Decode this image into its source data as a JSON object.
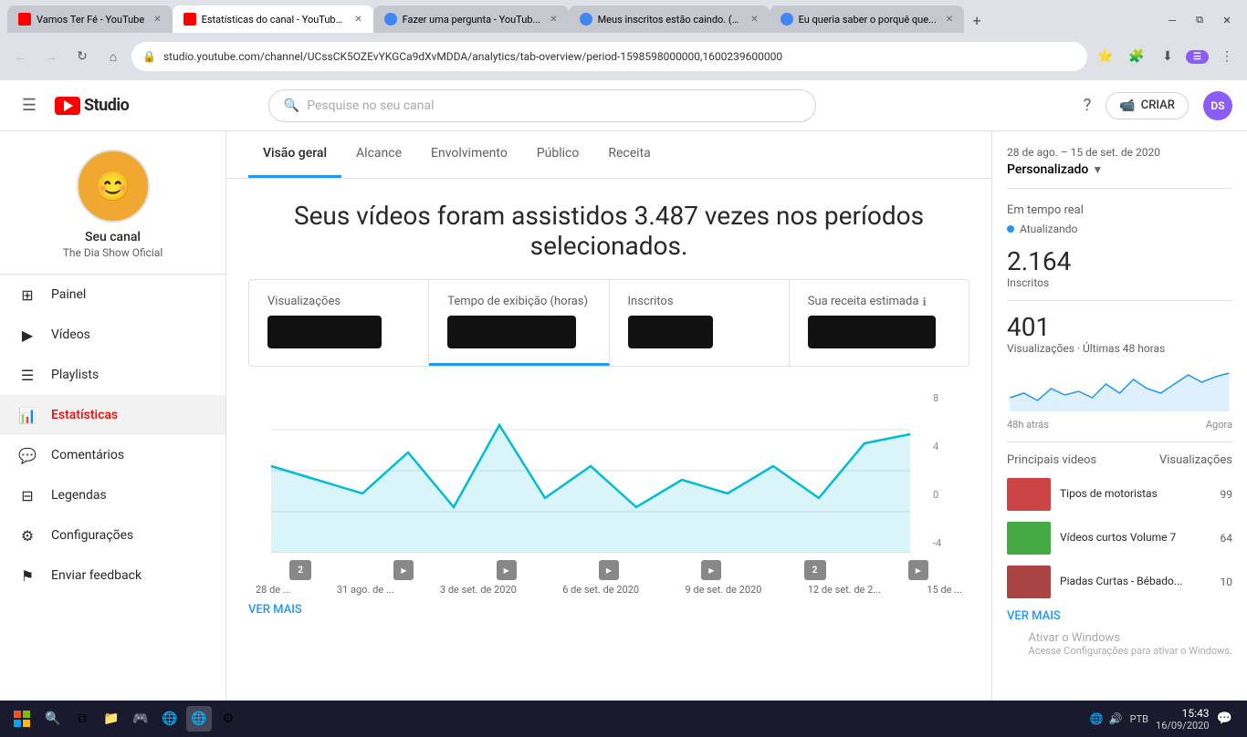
{
  "browser": {
    "tabs": [
      {
        "label": "Vamos Ter Fé - YouTube",
        "active": false,
        "type": "yt"
      },
      {
        "label": "Estatísticas do canal - YouTube...",
        "active": true,
        "type": "yt"
      },
      {
        "label": "Fazer uma pergunta - YouTub...",
        "active": false,
        "type": "g"
      },
      {
        "label": "Meus inscritos estão caindo. (M...",
        "active": false,
        "type": "g"
      },
      {
        "label": "Eu queria saber o porquê que...",
        "active": false,
        "type": "g"
      }
    ],
    "address": "studio.youtube.com/channel/UCssCK5OZEvYKGCa9dXvMDDA/analytics/tab-overview/period-1598598000000,1600239600000",
    "actions": [
      "⭐",
      "🧩",
      "⬇",
      "☰"
    ]
  },
  "header": {
    "search_placeholder": "Pesquise no seu canal",
    "create_label": "CRIAR",
    "logo_text": "Studio"
  },
  "sidebar": {
    "channel_name": "Seu canal",
    "channel_handle": "The Dia Show Oficial",
    "nav_items": [
      {
        "label": "Painel",
        "icon": "grid",
        "active": false
      },
      {
        "label": "Vídeos",
        "icon": "video",
        "active": false
      },
      {
        "label": "Playlists",
        "icon": "list",
        "active": false
      },
      {
        "label": "Estatísticas",
        "icon": "bar-chart",
        "active": true
      },
      {
        "label": "Comentários",
        "icon": "comment",
        "active": false
      },
      {
        "label": "Legendas",
        "icon": "subtitles",
        "active": false
      },
      {
        "label": "Configurações",
        "icon": "settings",
        "active": false
      },
      {
        "label": "Enviar feedback",
        "icon": "feedback",
        "active": false
      }
    ]
  },
  "analytics": {
    "tabs": [
      {
        "label": "Visão geral",
        "active": true
      },
      {
        "label": "Alcance",
        "active": false
      },
      {
        "label": "Envolvimento",
        "active": false
      },
      {
        "label": "Público",
        "active": false
      },
      {
        "label": "Receita",
        "active": false
      }
    ],
    "hero_text": "Seus vídeos foram assistidos 3.487 vezes nos períodos selecionados.",
    "stats": [
      {
        "label": "Visualizações",
        "active": false
      },
      {
        "label": "Tempo de exibição (horas)",
        "active": true
      },
      {
        "label": "Inscritos",
        "active": false
      },
      {
        "label": "Sua receita estimada",
        "active": false
      }
    ],
    "chart_labels": {
      "y_values": [
        "8",
        "4",
        "0",
        "-4"
      ]
    },
    "date_labels": [
      "28 de ...",
      "31 ago. de ...",
      "3 de set. de 2020",
      "6 de set. de 2020",
      "9 de set. de 2020",
      "12 de set. de 2...",
      "15 de ..."
    ],
    "ver_mais": "VER MAIS"
  },
  "right_panel": {
    "date_range": "28 de ago. – 15 de set. de 2020",
    "period": "Personalizado",
    "realtime_title": "Em tempo real",
    "realtime_status": "Atualizando",
    "subscribers_count": "2.164",
    "subscribers_label": "Inscritos",
    "views_count": "401",
    "views_label": "Visualizações · Últimas 48 horas",
    "time_start": "48h atrás",
    "time_end": "Agora",
    "top_videos_title": "Principais vídeos",
    "views_header": "Visualizações",
    "ver_mais": "VER MAIS",
    "videos": [
      {
        "title": "Tipos de motoristas",
        "views": "99"
      },
      {
        "title": "Vídeos curtos Volume 7",
        "views": "64"
      },
      {
        "title": "Piadas Curtas - Bébado...",
        "views": "10"
      }
    ]
  },
  "watermark": {
    "line1": "Ativar o Windows",
    "line2": "Acesse Configurações para ativar o Windows."
  },
  "taskbar": {
    "clock_time": "15:43",
    "clock_date": "16/09/2020",
    "lang": "PTB"
  }
}
